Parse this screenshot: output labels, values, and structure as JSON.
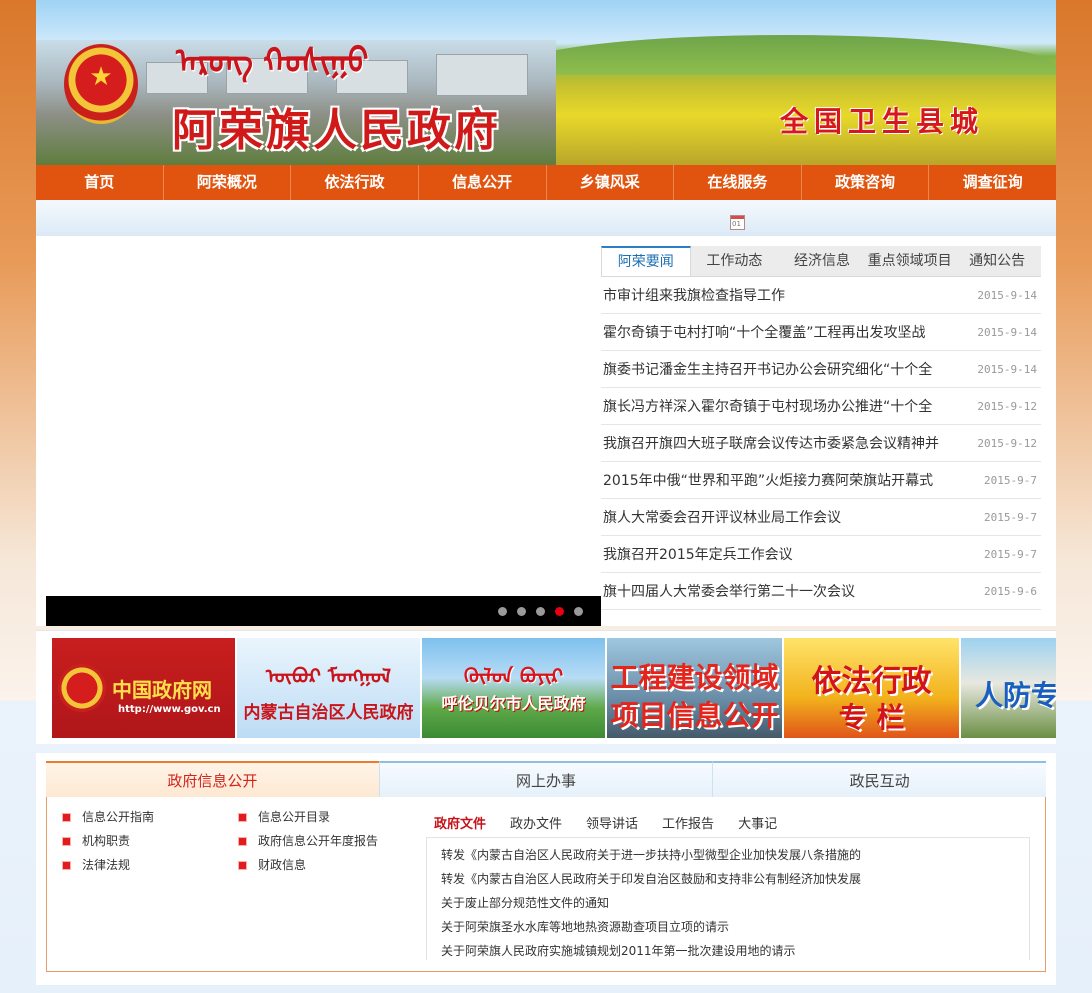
{
  "banner": {
    "mongolian_title": "ᠠᠷᠤᠩ ᠬᠣᠱᠢᠭᠤ",
    "site_title": "阿荣旗人民政府",
    "slogan": "全国卫生县城"
  },
  "nav": {
    "items": [
      "首页",
      "阿荣概况",
      "依法行政",
      "信息公开",
      "乡镇风采",
      "在线服务",
      "政策咨询",
      "调查征询"
    ]
  },
  "datebar": {
    "calendar_icon_text": "01"
  },
  "slider": {
    "dot_count": 5,
    "active_dot": 4
  },
  "news": {
    "tabs": [
      "阿荣要闻",
      "工作动态",
      "经济信息",
      "重点领域项目",
      "通知公告"
    ],
    "active_tab": 0,
    "items": [
      {
        "title": "市审计组来我旗检查指导工作",
        "date": "2015-9-14"
      },
      {
        "title": "霍尔奇镇于屯村打响“十个全覆盖”工程再出发攻坚战",
        "date": "2015-9-14"
      },
      {
        "title": "旗委书记潘金生主持召开书记办公会研究细化“十个全",
        "date": "2015-9-14"
      },
      {
        "title": "旗长冯方祥深入霍尔奇镇于屯村现场办公推进“十个全",
        "date": "2015-9-12"
      },
      {
        "title": "我旗召开旗四大班子联席会议传达市委紧急会议精神并",
        "date": "2015-9-12"
      },
      {
        "title": "2015年中俄“世界和平跑”火炬接力赛阿荣旗站开幕式",
        "date": "2015-9-7"
      },
      {
        "title": "旗人大常委会召开评议林业局工作会议",
        "date": "2015-9-7"
      },
      {
        "title": "我旗召开2015年定兵工作会议",
        "date": "2015-9-7"
      },
      {
        "title": "旗十四届人大常委会举行第二十一次会议",
        "date": "2015-9-6"
      }
    ]
  },
  "links": {
    "gov": {
      "title": "中国政府网",
      "url_text": "http://www.gov.cn"
    },
    "nmg": {
      "mongolian": "ᠥᠪᠦᠷ ᠮᠣᠩᠭᠣᠯ",
      "title": "内蒙古自治区人民政府"
    },
    "hlbe": {
      "mongolian": "ᠬᠥᠯᠦᠨ ᠪᠤᠶᠢᠷ",
      "title": "呼伦贝尔市人民政府"
    },
    "gcjs": {
      "line1": "工程建设领域",
      "line2": "项目信息公开"
    },
    "yfxz": {
      "line1": "依法行政",
      "line2": "专 栏"
    },
    "rf": {
      "title": "人防专"
    }
  },
  "bottom": {
    "tabs": [
      "政府信息公开",
      "网上办事",
      "政民互动"
    ],
    "active_tab": 0,
    "guide_left": [
      "信息公开指南",
      "机构职责",
      "法律法规"
    ],
    "guide_right": [
      "信息公开目录",
      "政府信息公开年度报告",
      "财政信息"
    ],
    "doc_tabs": [
      "政府文件",
      "政办文件",
      "领导讲话",
      "工作报告",
      "大事记"
    ],
    "active_doc_tab": 0,
    "docs": [
      "转发《内蒙古自治区人民政府关于进一步扶持小型微型企业加快发展八条措施的",
      "转发《内蒙古自治区人民政府关于印发自治区鼓励和支持非公有制经济加快发展",
      "关于废止部分规范性文件的通知",
      "关于阿荣旗圣水水库等地地热资源勘查项目立项的请示",
      "关于阿荣旗人民政府实施城镇规划2011年第一批次建设用地的请示"
    ]
  },
  "colors": {
    "nav": "#e0540f",
    "accent_red": "#d01a1a",
    "tab_blue": "#1b6fb5",
    "slider_active_dot": "#e60012"
  }
}
